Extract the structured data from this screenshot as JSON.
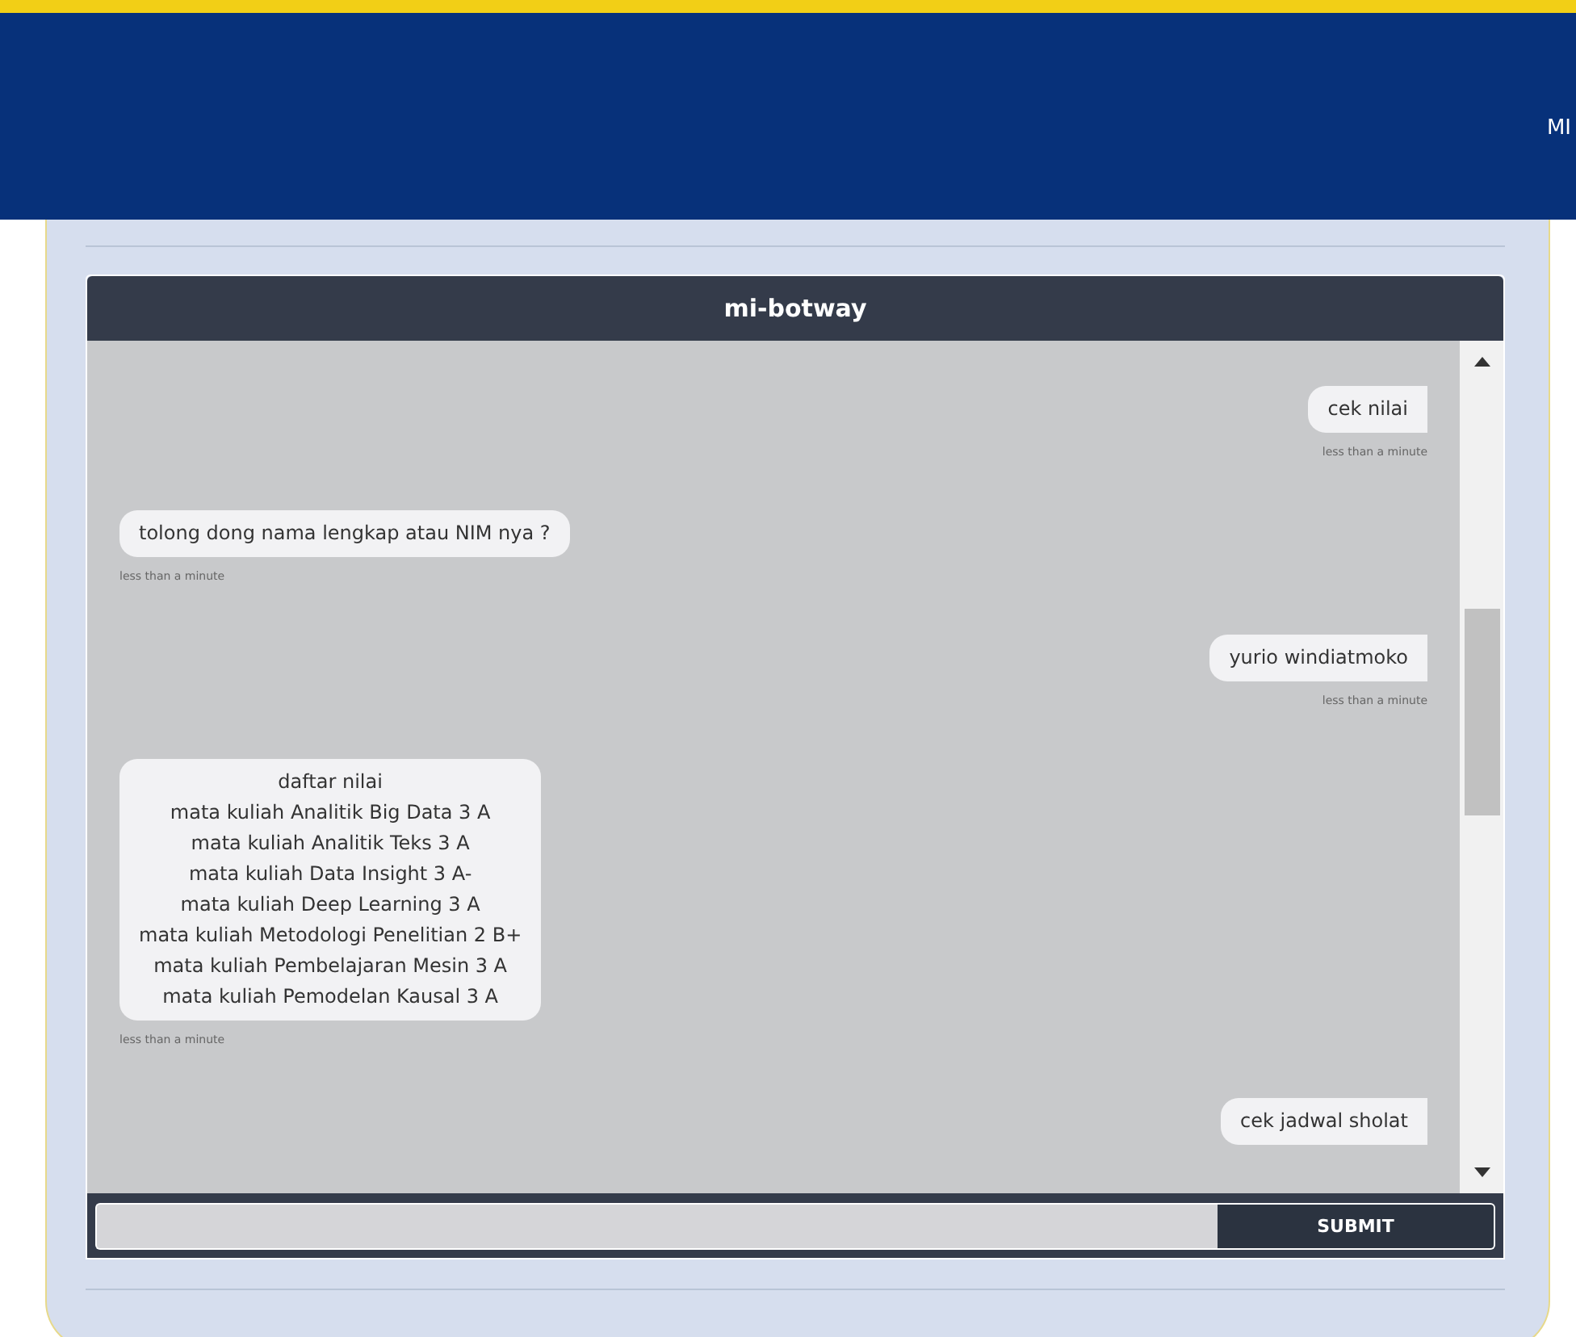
{
  "header": {
    "nav_text": "MI"
  },
  "chat": {
    "title": "mi-botway",
    "messages": [
      {
        "kind": "outgoing",
        "lines": [
          "cek nilai"
        ],
        "time": "less than a minute"
      },
      {
        "kind": "incoming",
        "lines": [
          "tolong dong nama lengkap atau NIM nya ?"
        ],
        "time": "less than a minute"
      },
      {
        "kind": "outgoing",
        "lines": [
          "yurio windiatmoko"
        ],
        "time": "less than a minute"
      },
      {
        "kind": "incoming",
        "lines": [
          "daftar nilai",
          "mata kuliah Analitik Big Data 3 A",
          "mata kuliah Analitik Teks 3 A",
          "mata kuliah Data Insight 3 A-",
          "mata kuliah Deep Learning 3 A",
          "mata kuliah Metodologi Penelitian 2 B+",
          "mata kuliah Pembelajaran Mesin 3 A",
          "mata kuliah Pemodelan Kausal 3 A"
        ],
        "time": "less than a minute"
      },
      {
        "kind": "outgoing",
        "lines": [
          "cek jadwal sholat"
        ]
      }
    ],
    "submit_label": "SUBMIT"
  }
}
